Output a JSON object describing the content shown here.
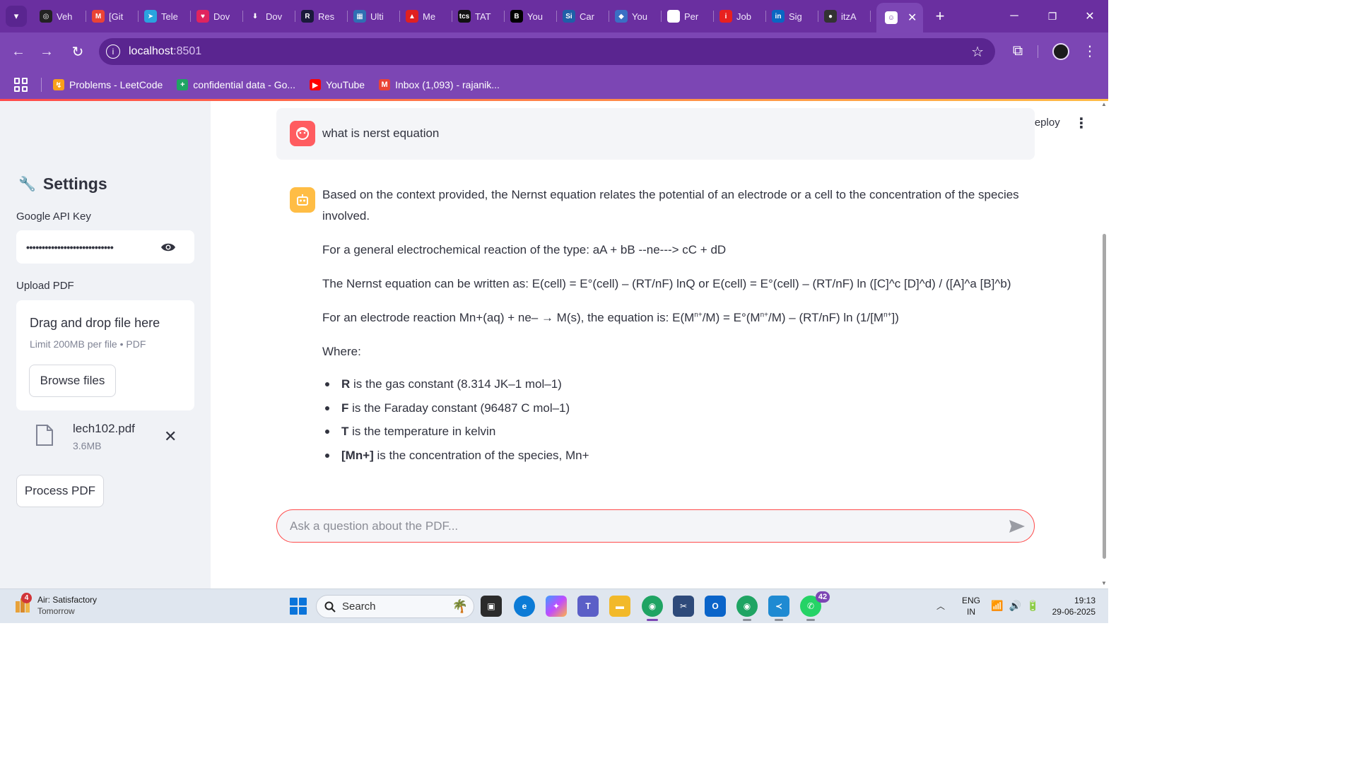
{
  "browser": {
    "tabs": [
      {
        "title": "Veh",
        "icon": "openai-icon",
        "color": "#222222",
        "glyph": "◎"
      },
      {
        "title": "[Git",
        "icon": "gmail-icon",
        "color": "#ea4335",
        "glyph": "M"
      },
      {
        "title": "Tele",
        "icon": "telegram-icon",
        "color": "#2aa3df",
        "glyph": "➤"
      },
      {
        "title": "Dov",
        "icon": "heart-icon",
        "color": "#e0245e",
        "glyph": "♥"
      },
      {
        "title": "Dov",
        "icon": "download-icon",
        "color": "#6a2fa0",
        "glyph": "⬇"
      },
      {
        "title": "Res",
        "icon": "r-icon",
        "color": "#1a1a3a",
        "glyph": "R"
      },
      {
        "title": "Ulti",
        "icon": "tata-icon",
        "color": "#2f6fb3",
        "glyph": "▦"
      },
      {
        "title": "Me",
        "icon": "mercedes-icon",
        "color": "#e02020",
        "glyph": "▲"
      },
      {
        "title": "TAT",
        "icon": "tcs-icon",
        "color": "#111111",
        "glyph": "tcs"
      },
      {
        "title": "You",
        "icon": "b-icon",
        "color": "#000000",
        "glyph": "B"
      },
      {
        "title": "Car",
        "icon": "si-icon",
        "color": "#1f5fa8",
        "glyph": "Si"
      },
      {
        "title": "You",
        "icon": "diamond-icon",
        "color": "#3a6fc4",
        "glyph": "◆"
      },
      {
        "title": "Per",
        "icon": "page-icon",
        "color": "#ffffff",
        "glyph": ""
      },
      {
        "title": "Job",
        "icon": "jobs-icon",
        "color": "#e8201f",
        "glyph": "i"
      },
      {
        "title": "Sig",
        "icon": "linkedin-icon",
        "color": "#0a66c2",
        "glyph": "in"
      },
      {
        "title": "itzA",
        "icon": "github-icon",
        "color": "#333333",
        "glyph": "●"
      }
    ],
    "url_host": "localhost",
    "url_port": ":8501",
    "bookmarks": [
      {
        "label": "Problems - LeetCode",
        "icon": "leetcode-icon",
        "color": "#f89f1b",
        "glyph": "↯"
      },
      {
        "label": "confidential data - Go...",
        "icon": "google-sheets-icon",
        "color": "#1fa463",
        "glyph": "+"
      },
      {
        "label": "YouTube",
        "icon": "youtube-icon",
        "color": "#ff0000",
        "glyph": "▶"
      },
      {
        "label": "Inbox (1,093) - rajanik...",
        "icon": "gmail-icon",
        "color": "#ea4335",
        "glyph": "M"
      }
    ]
  },
  "sidebar": {
    "title": "Settings",
    "api_key_label": "Google API Key",
    "api_key_value": "••••••••••••••••••••••••••••",
    "upload_label": "Upload PDF",
    "dropzone_title": "Drag and drop file here",
    "dropzone_limit": "Limit 200MB per file • PDF",
    "browse_label": "Browse files",
    "file_name": "lech102.pdf",
    "file_size": "3.6MB",
    "process_label": "Process PDF"
  },
  "main": {
    "deploy_label": "Deploy",
    "user_message": "what is nerst equation",
    "bot": {
      "p1": "Based on the context provided, the Nernst equation relates the potential of an electrode or a cell to the concentration of the species involved.",
      "p2": "For a general electrochemical reaction of the type: aA + bB --ne---> cC + dD",
      "p3": "The Nernst equation can be written as: E(cell) = E°(cell) – (RT/nF) lnQ or E(cell) = E°(cell) – (RT/nF) ln ([C]^c [D]^d) / ([A]^a [B]^b)",
      "p4": {
        "a": "For an electrode reaction Mn+(aq) + ne– → M(s), the equation is: E(M",
        "b": "/M) = E°(M",
        "c": "/M) – (RT/nF) ln (1/[M",
        "d": "])",
        "sup": "n+"
      },
      "where": "Where:",
      "definitions": [
        {
          "term": "R",
          "text": " is the gas constant (8.314 JK–1 mol–1)"
        },
        {
          "term": "F",
          "text": " is the Faraday constant (96487 C mol–1)"
        },
        {
          "term": "T",
          "text": " is the temperature in kelvin"
        },
        {
          "term": "[Mn+]",
          "text": " is the concentration of the species, Mn+"
        }
      ]
    },
    "input_placeholder": "Ask a question about the PDF..."
  },
  "taskbar": {
    "weather_badge": "4",
    "weather_title": "Air: Satisfactory",
    "weather_sub": "Tomorrow",
    "search_label": "Search",
    "teams_badge": "42",
    "lang_line1": "ENG",
    "lang_line2": "IN",
    "time": "19:13",
    "date": "29-06-2025"
  },
  "colors": {
    "brand_purple": "#7c46b4",
    "streamlit_red": "#ff4b4b",
    "streamlit_yellow": "#ffbd45"
  }
}
